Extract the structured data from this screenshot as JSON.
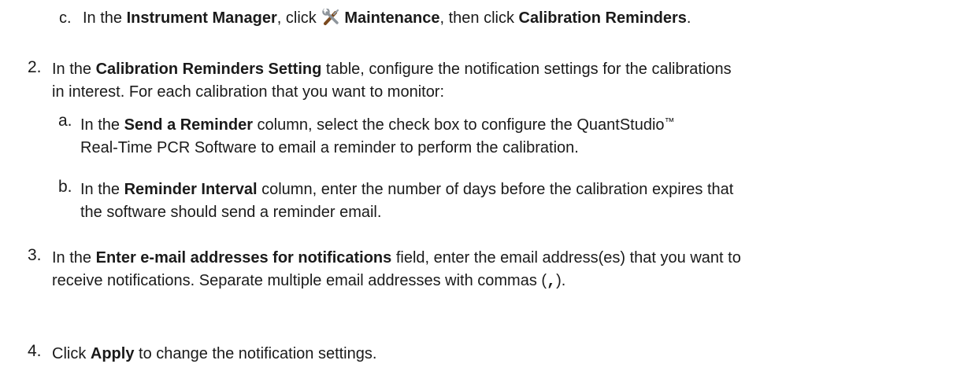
{
  "steps": {
    "c": {
      "label": "c.",
      "t1": "In the ",
      "b1": "Instrument Manager",
      "t2": ", click ",
      "icon": "wrench-screwdriver-icon",
      "b2": "Maintenance",
      "t3": ", then click ",
      "b3": "Calibration Reminders",
      "t4": "."
    },
    "s2": {
      "label": "2.",
      "t1": "In the ",
      "b1": "Calibration Reminders Setting",
      "t2": " table, configure the notification settings for the calibrations",
      "line2": "in interest. For each calibration that you want to monitor:"
    },
    "s2a": {
      "label": "a.",
      "t1": "In the ",
      "b1": "Send a Reminder",
      "t2": " column, select the check box to configure the QuantStudio",
      "tm": "™",
      "line2": "Real-Time PCR Software to email a reminder to perform the calibration."
    },
    "s2b": {
      "label": "b.",
      "t1": "In the ",
      "b1": "Reminder Interval",
      "t2": " column, enter the number of days before the calibration expires that",
      "line2": "the software should send a reminder email."
    },
    "s3": {
      "label": "3.",
      "t1": "In the ",
      "b1": "Enter e-mail addresses for notifications",
      "t2": " field, enter the email address(es) that you want to",
      "line2a": "receive notifications. Separate multiple email addresses with commas (",
      "comma": ",",
      "line2b": ")."
    },
    "s4": {
      "label": "4.",
      "t1": "Click ",
      "b1": "Apply",
      "t2": " to change the notification settings."
    }
  }
}
